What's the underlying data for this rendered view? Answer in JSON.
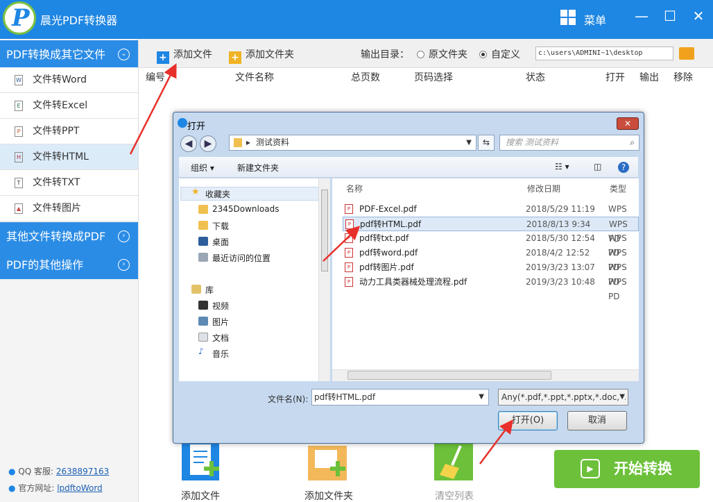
{
  "app": {
    "title": "晨光PDF转换器",
    "logo_letter": "P",
    "menu_label": "菜单",
    "minimize": "—",
    "maximize": "☐",
    "close": "✕"
  },
  "sidebar": {
    "section1": {
      "label": "PDF转换成其它文件",
      "toggle": "⌄"
    },
    "items": [
      {
        "label": "文件转Word",
        "icon": "W"
      },
      {
        "label": "文件转Excel",
        "icon": "E"
      },
      {
        "label": "文件转PPT",
        "icon": "P"
      },
      {
        "label": "文件转HTML",
        "icon": "H"
      },
      {
        "label": "文件转TXT",
        "icon": "T"
      },
      {
        "label": "文件转图片",
        "icon": "▲"
      }
    ],
    "section2": {
      "label": "其他文件转换成PDF",
      "toggle": "›"
    },
    "section3": {
      "label": "PDF的其他操作",
      "toggle": "›"
    },
    "qq_label": "QQ 客服:",
    "qq_number": "2638897163",
    "web_label": "官方网址:",
    "web_link": "lpdftoWord"
  },
  "toolbar": {
    "add_file": "添加文件",
    "add_folder": "添加文件夹",
    "output_label": "输出目录：",
    "opt_source": "原文件夹",
    "opt_custom": "自定义",
    "output_path": "c:\\users\\ADMINI~1\\desktop"
  },
  "columns": [
    "编号",
    "文件名称",
    "总页数",
    "页码选择",
    "状态",
    "打开",
    "输出",
    "移除"
  ],
  "bottom": {
    "add_file": "添加文件",
    "add_folder": "添加文件夹",
    "clear_list": "清空列表",
    "start": "开始转换"
  },
  "dialog": {
    "title": "打开",
    "close": "✕",
    "address": "测试资料",
    "search_placeholder": "搜索 测试资料",
    "organize": "组织 ▾",
    "new_folder": "新建文件夹",
    "nav": {
      "favorites": "收藏夹",
      "downloads": "2345Downloads",
      "download": "下载",
      "desktop": "桌面",
      "recent": "最近访问的位置",
      "library": "库",
      "video": "视频",
      "pictures": "图片",
      "documents": "文档",
      "music": "音乐"
    },
    "headers": {
      "name": "名称",
      "date": "修改日期",
      "type": "类型"
    },
    "files": [
      {
        "name": "PDF-Excel.pdf",
        "date": "2018/5/29 11:19",
        "type": "WPS PD"
      },
      {
        "name": "pdf转HTML.pdf",
        "date": "2018/8/13 9:34",
        "type": "WPS PD"
      },
      {
        "name": "pdf转txt.pdf",
        "date": "2018/5/30 12:54",
        "type": "WPS PD"
      },
      {
        "name": "pdf转word.pdf",
        "date": "2018/4/2 12:52",
        "type": "WPS PD"
      },
      {
        "name": "pdf转图片.pdf",
        "date": "2019/3/23 13:07",
        "type": "WPS PD"
      },
      {
        "name": "动力工具类器械处理流程.pdf",
        "date": "2019/3/23 10:48",
        "type": "WPS PD"
      }
    ],
    "filename_label": "文件名(N):",
    "filename_value": "pdf转HTML.pdf",
    "filetype": "Any(*.pdf,*.ppt,*.pptx,*.doc,*.",
    "open_btn": "打开(O)",
    "cancel_btn": "取消"
  }
}
